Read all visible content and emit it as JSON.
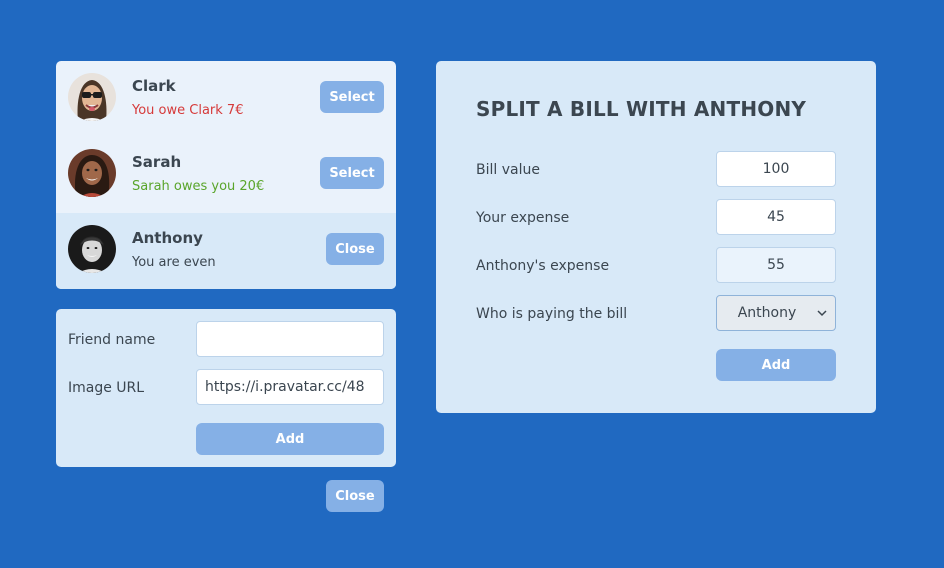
{
  "friends": [
    {
      "name": "Clark",
      "status": "You owe Clark 7€",
      "status_color": "#d63a3a",
      "button": "Select",
      "avatar_icon": "avatar-clark"
    },
    {
      "name": "Sarah",
      "status": "Sarah owes you 20€",
      "status_color": "#5aa52b",
      "button": "Select",
      "avatar_icon": "avatar-sarah"
    },
    {
      "name": "Anthony",
      "status": "You are even",
      "status_color": "#3b4650",
      "button": "Close",
      "avatar_icon": "avatar-anthony",
      "selected": true
    }
  ],
  "add_friend": {
    "name_label": "Friend name",
    "name_value": "",
    "image_label": "Image URL",
    "image_value": "https://i.pravatar.cc/48",
    "add_label": "Add",
    "close_label": "Close"
  },
  "split": {
    "title": "SPLIT A BILL WITH ANTHONY",
    "bill_label": "Bill value",
    "bill_value": "100",
    "your_label": "Your expense",
    "your_value": "45",
    "friend_label": "Anthony's expense",
    "friend_value": "55",
    "payer_label": "Who is paying the bill",
    "payer_value": "Anthony",
    "add_label": "Add"
  },
  "colors": {
    "background": "#2069c1",
    "card": "#d8e9f8",
    "button": "#85b0e6",
    "owe": "#d63a3a",
    "owed": "#5aa52b"
  }
}
